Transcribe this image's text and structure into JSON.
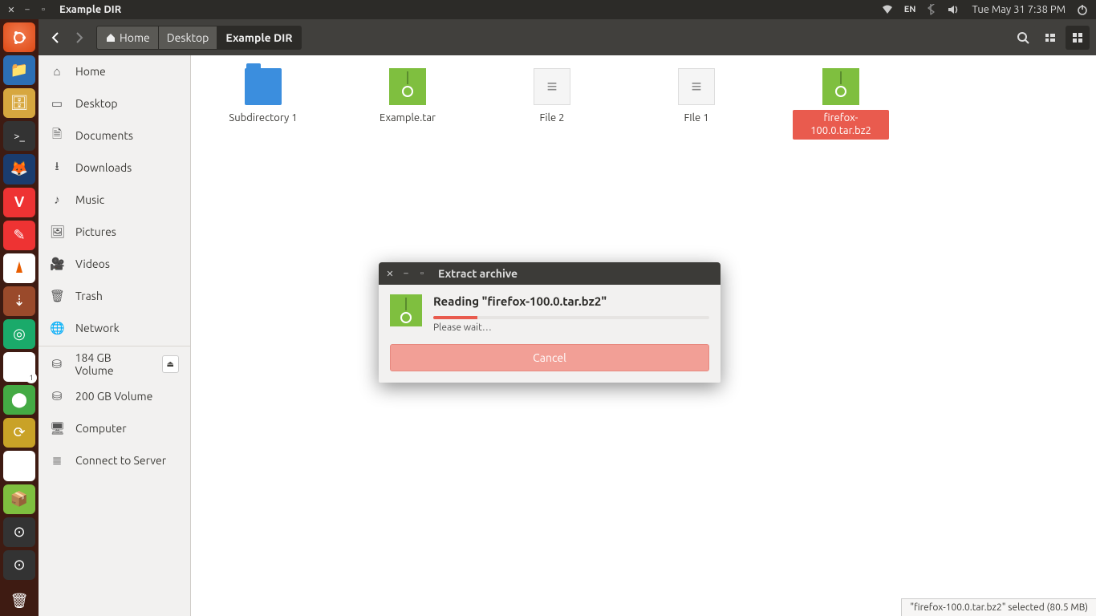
{
  "top_panel": {
    "window_title": "Example DIR",
    "lang": "EN",
    "datetime": "Tue May 31  7:38 PM"
  },
  "toolbar": {
    "breadcrumb": [
      "Home",
      "Desktop",
      "Example DIR"
    ]
  },
  "sidebar": {
    "places": [
      {
        "icon": "home",
        "label": "Home"
      },
      {
        "icon": "desktop",
        "label": "Desktop"
      },
      {
        "icon": "doc",
        "label": "Documents"
      },
      {
        "icon": "download",
        "label": "Downloads"
      },
      {
        "icon": "music",
        "label": "Music"
      },
      {
        "icon": "pictures",
        "label": "Pictures"
      },
      {
        "icon": "videos",
        "label": "Videos"
      },
      {
        "icon": "trash",
        "label": "Trash"
      },
      {
        "icon": "network",
        "label": "Network"
      }
    ],
    "devices": [
      {
        "icon": "hdd",
        "label": "184 GB Volume",
        "eject": true
      },
      {
        "icon": "hdd",
        "label": "200 GB Volume"
      },
      {
        "icon": "computer",
        "label": "Computer"
      },
      {
        "icon": "server",
        "label": "Connect to Server"
      }
    ]
  },
  "files": [
    {
      "type": "folder",
      "label": "Subdirectory 1",
      "selected": false
    },
    {
      "type": "archive",
      "label": "Example.tar",
      "selected": false
    },
    {
      "type": "textfile",
      "label": "File 2",
      "selected": false
    },
    {
      "type": "textfile",
      "label": "FIle 1",
      "selected": false
    },
    {
      "type": "archive",
      "label": "firefox-100.0.tar.bz2",
      "selected": true
    }
  ],
  "status": "\"firefox-100.0.tar.bz2\" selected  (80.5 MB)",
  "dialog": {
    "title": "Extract archive",
    "message": "Reading \"firefox-100.0.tar.bz2\"",
    "wait": "Please wait…",
    "cancel": "Cancel",
    "progress_pct": 16
  }
}
